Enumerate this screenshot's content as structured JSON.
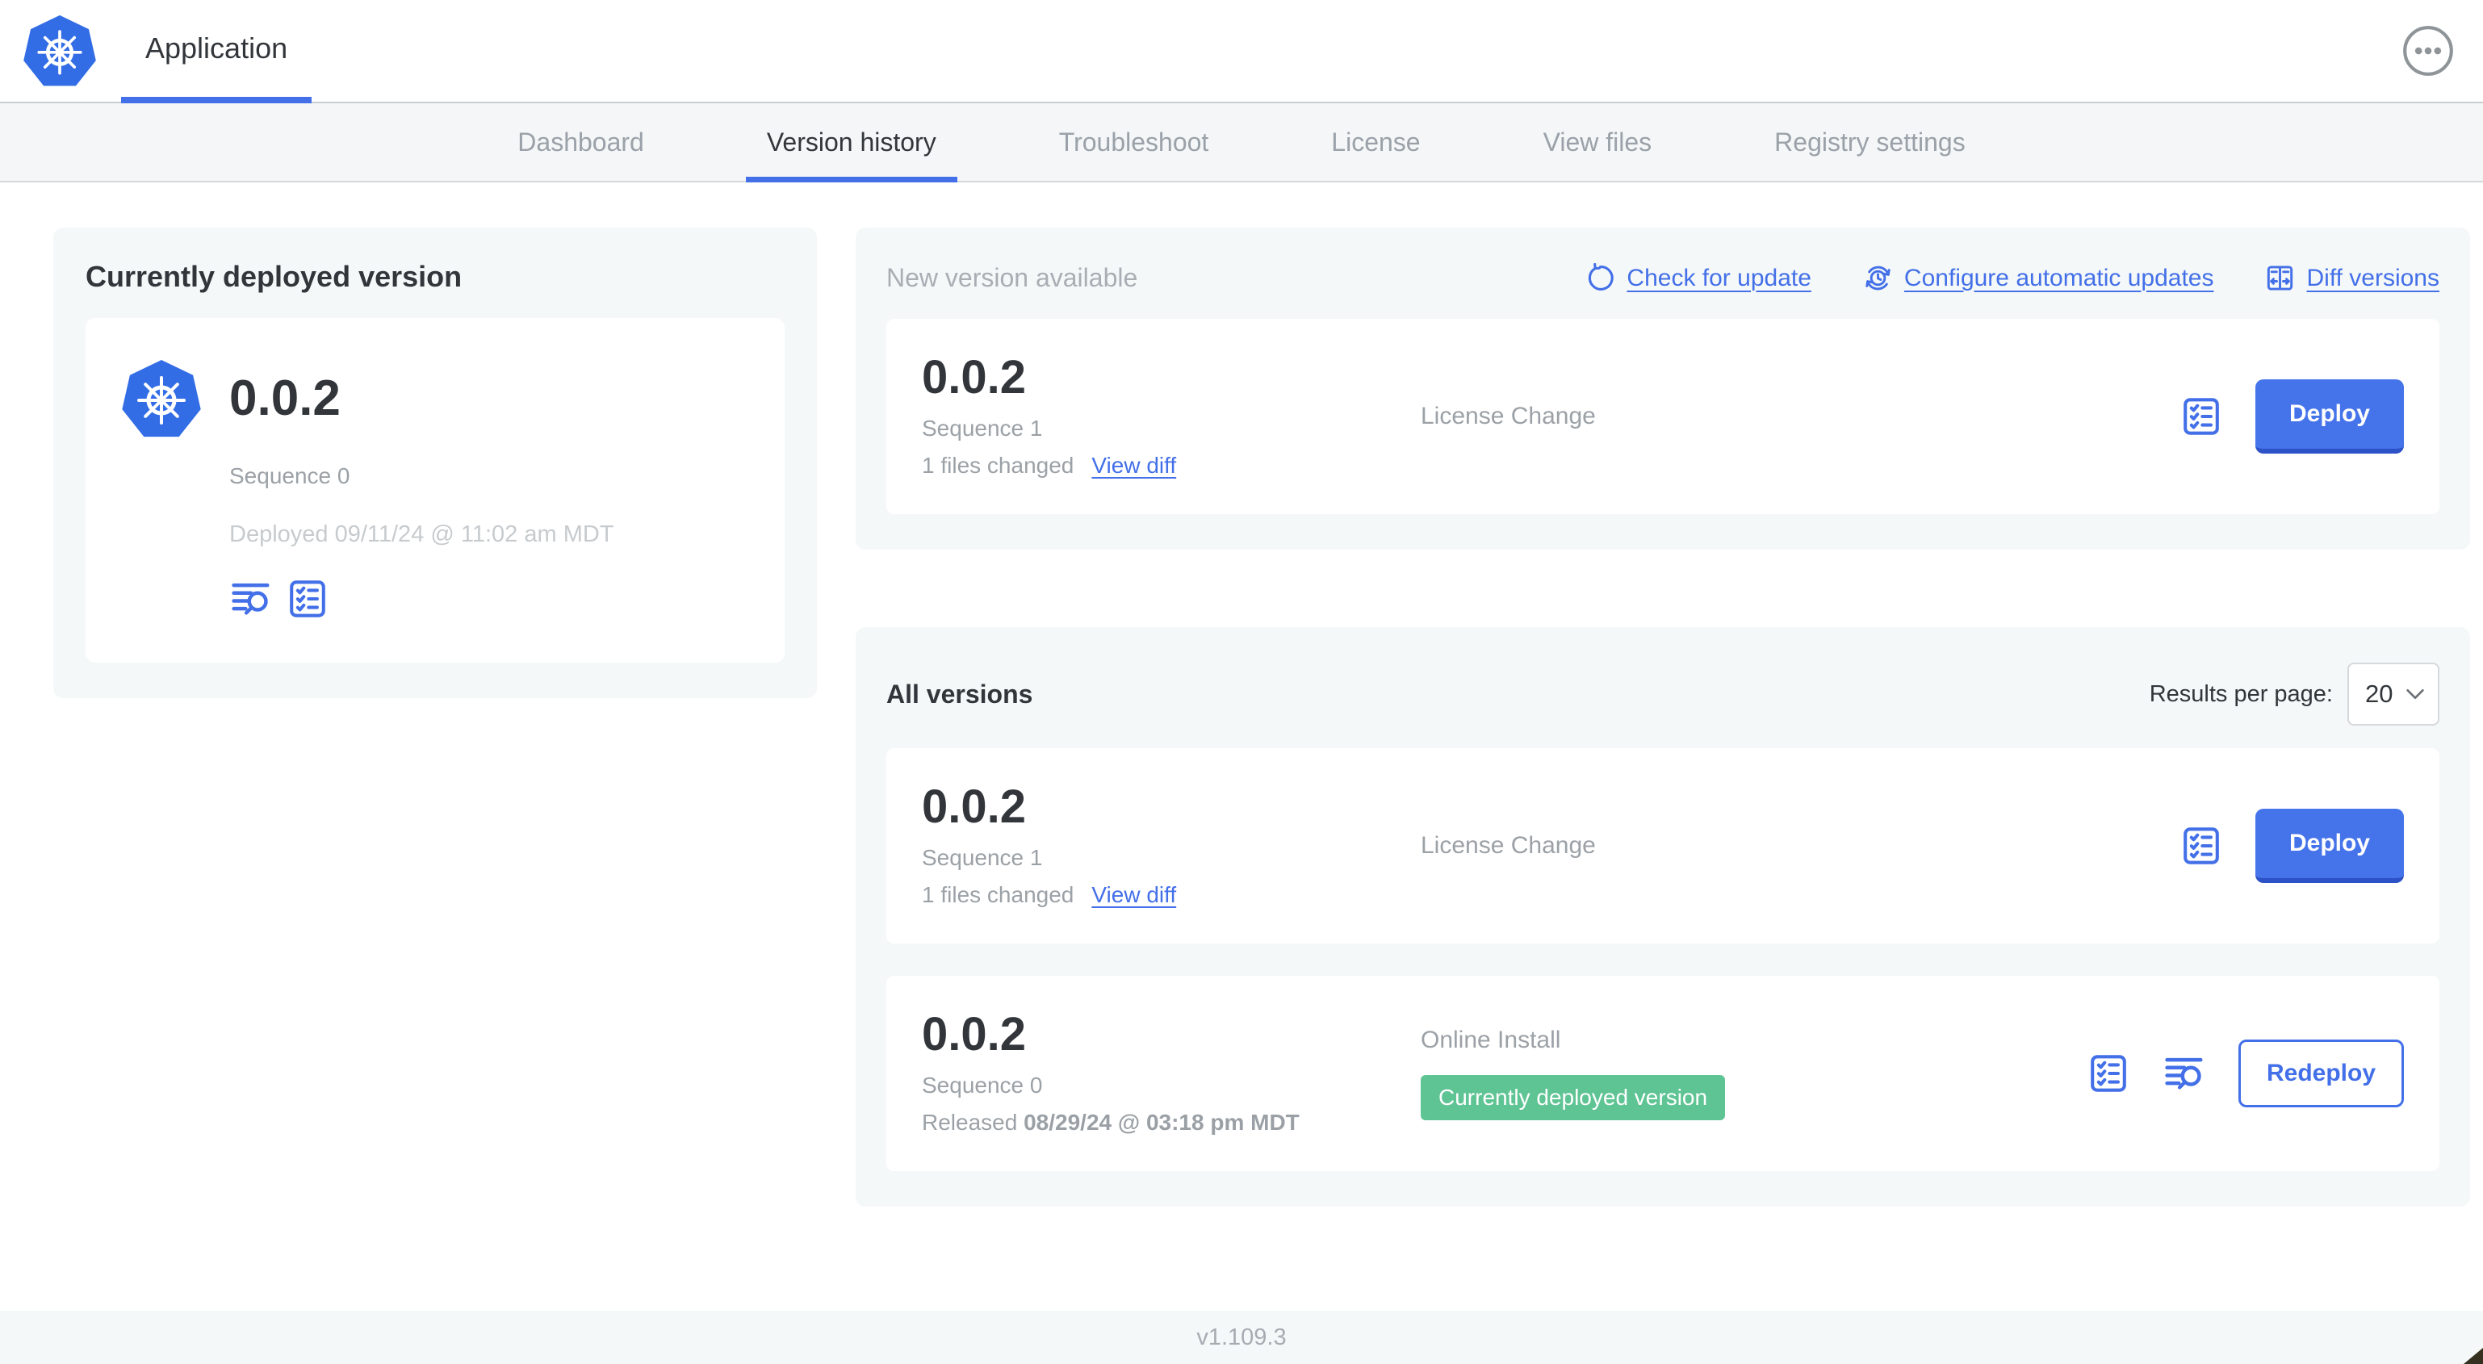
{
  "header": {
    "app_title": "Application"
  },
  "nav_tabs": [
    {
      "label": "Dashboard"
    },
    {
      "label": "Version history"
    },
    {
      "label": "Troubleshoot"
    },
    {
      "label": "License"
    },
    {
      "label": "View files"
    },
    {
      "label": "Registry settings"
    }
  ],
  "currently_deployed": {
    "title": "Currently deployed version",
    "version": "0.0.2",
    "sequence": "Sequence 0",
    "deployed_at": "Deployed 09/11/24 @ 11:02 am MDT"
  },
  "new_version": {
    "title": "New version available",
    "actions": {
      "check_for_update": "Check for update",
      "configure_automatic_updates": "Configure automatic updates",
      "diff_versions": "Diff versions"
    },
    "row": {
      "version": "0.0.2",
      "sequence": "Sequence 1",
      "files_changed": "1 files changed",
      "view_diff": "View diff",
      "source": "License Change",
      "action": "Deploy"
    }
  },
  "all_versions": {
    "title": "All versions",
    "results_per_page_label": "Results per page:",
    "results_per_page_value": "20",
    "rows": [
      {
        "version": "0.0.2",
        "sequence": "Sequence 1",
        "files_changed": "1 files changed",
        "view_diff": "View diff",
        "source": "License Change",
        "action": "Deploy"
      },
      {
        "version": "0.0.2",
        "sequence": "Sequence 0",
        "released_prefix": "Released",
        "released_date": "08/29/24 @ 03:18 pm MDT",
        "source": "Online Install",
        "status_badge": "Currently deployed version",
        "action": "Redeploy"
      }
    ]
  },
  "footer": {
    "app_version": "v1.109.3"
  },
  "colors": {
    "accent_blue": "#4370e8",
    "button_blue": "#4573ea",
    "button_blue_shadow": "#2d51c6",
    "logo_blue": "#326de6",
    "badge_green": "#5fc494",
    "panel_bg": "#f5f8f9",
    "subnav_bg": "#f4f6f8",
    "muted_text": "#9ba1a6",
    "faint_text": "#c7cbce"
  },
  "icons": {
    "kubernetes-logo": "white ship wheel inside blue heptagon",
    "ellipsis-menu-icon": "three dots in circle",
    "refresh-icon": "circular arrow",
    "clock-refresh-icon": "clock with circular update arrows",
    "diff-icon": "two-column box with outward arrows",
    "checklist-icon": "checklist inside rounded square",
    "logs-icon": "log lines with magnifying glass",
    "chevron-down-icon": "downward chevron"
  }
}
